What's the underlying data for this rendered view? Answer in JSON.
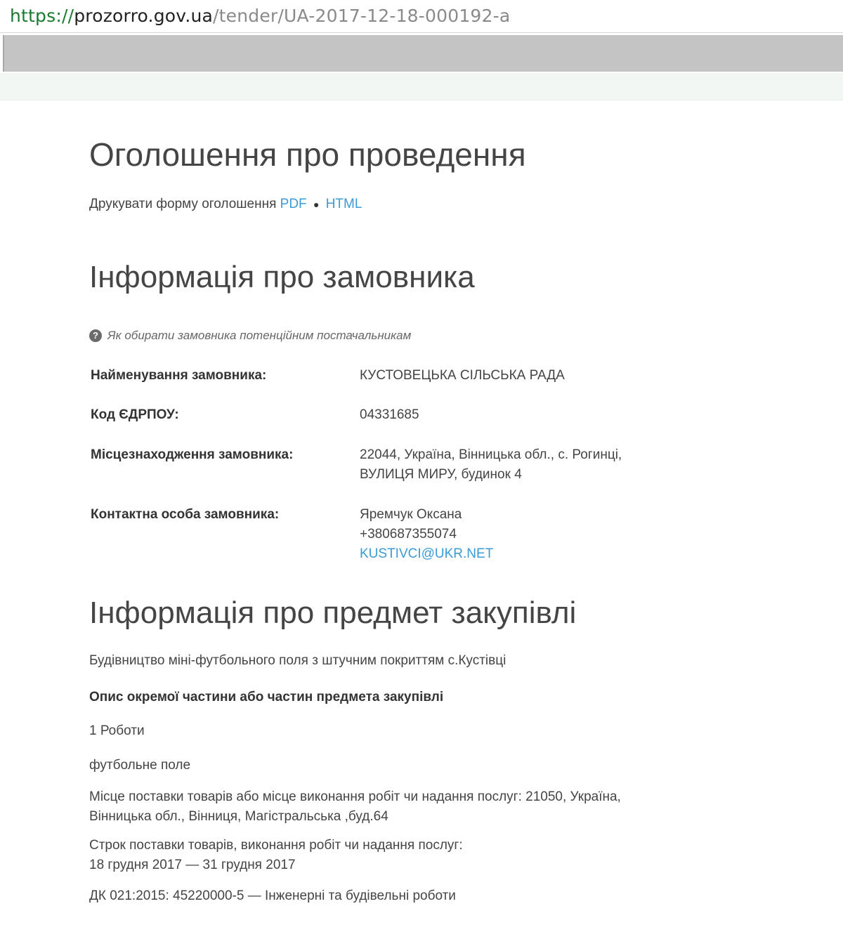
{
  "browser": {
    "url_scheme": "https://",
    "url_host": "prozorro.gov.ua",
    "url_path": "/tender/UA-2017-12-18-000192-a"
  },
  "page": {
    "title": "Оголошення про проведення",
    "print_label": "Друкувати форму оголошення",
    "print_pdf": "PDF",
    "print_separator": "●",
    "print_html": "HTML"
  },
  "customer": {
    "heading": "Інформація про замовника",
    "hint": "Як обирати замовника потенційним постачальникам",
    "name_label": "Найменування замовника:",
    "name_value": "КУСТОВЕЦЬКА СІЛЬСЬКА РАДА",
    "code_label": "Код ЄДРПОУ:",
    "code_value": "04331685",
    "address_label": "Місцезнаходження замовника:",
    "address_line1": "22044, Україна, Вінницька обл., с. Рогинці,",
    "address_line2": "ВУЛИЦЯ МИРУ, будинок 4",
    "contact_label": "Контактна особа замовника:",
    "contact_name": "Яремчук Оксана",
    "contact_phone": "+380687355074",
    "contact_email": "KUSTIVCI@UKR.NET"
  },
  "subject": {
    "heading": "Інформація про предмет закупівлі",
    "description": "Будівництво міні-футбольного поля з штучним покриттям с.Кустівці",
    "lots_heading": "Опис окремої частини або частин предмета закупівлі",
    "quantity": "1 Роботи",
    "item_name": "футбольне поле",
    "delivery_place_line1": "Місце поставки товарів або місце виконання робіт чи надання послуг: 21050, Україна,",
    "delivery_place_line2": "Вінницька обл., Вінниця, Магістральська ,буд.64",
    "delivery_term_label": "Строк поставки товарів, виконання робіт чи надання послуг:",
    "delivery_term_dates": "18 грудня 2017  —  31 грудня 2017",
    "classifier": "ДК 021:2015: 45220000-5 — Інженерні та будівельні роботи"
  }
}
